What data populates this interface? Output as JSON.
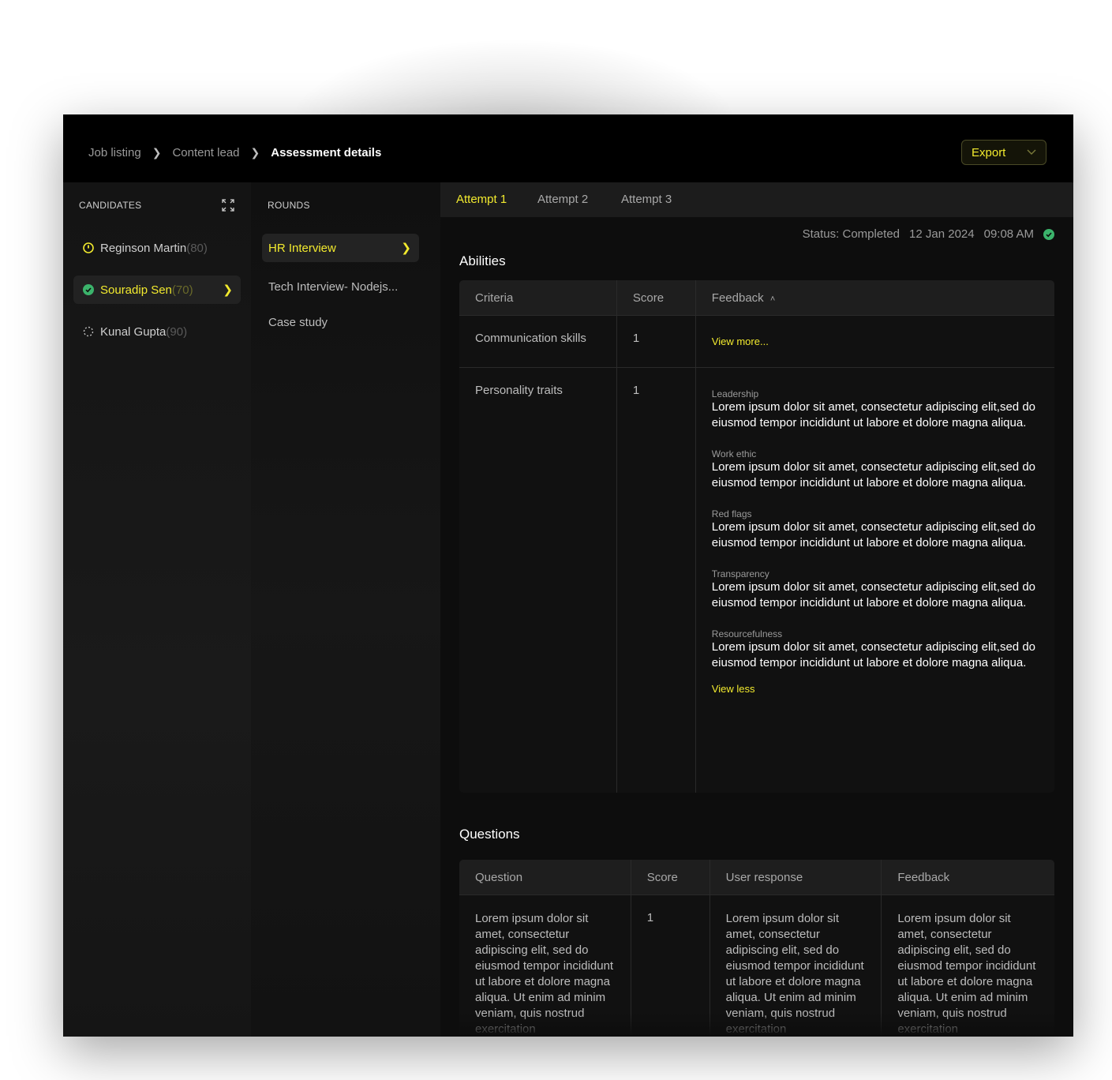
{
  "breadcrumb": {
    "items": [
      "Job listing",
      "Content lead"
    ],
    "current": "Assessment details"
  },
  "export": {
    "label": "Export"
  },
  "candidates": {
    "header": "CANDIDATES",
    "items": [
      {
        "name": "Reginson Martin",
        "score": "(80)",
        "status": "pending"
      },
      {
        "name": "Souradip Sen",
        "score": "(70)",
        "status": "completed"
      },
      {
        "name": "Kunal Gupta",
        "score": "(90)",
        "status": "loading"
      }
    ]
  },
  "rounds": {
    "header": "ROUNDS",
    "items": [
      "HR Interview",
      "Tech Interview- Nodejs...",
      "Case study"
    ]
  },
  "attempts": {
    "tabs": [
      "Attempt 1",
      "Attempt 2",
      "Attempt 3"
    ]
  },
  "status": {
    "label": "Status: Completed",
    "date": "12 Jan 2024",
    "time": "09:08 AM"
  },
  "abilities": {
    "title": "Abilities",
    "columns": [
      "Criteria",
      "Score",
      "Feedback"
    ],
    "rows": [
      {
        "criteria": "Communication skills",
        "score": "1",
        "link": "View more..."
      },
      {
        "criteria": "Personality traits",
        "score": "1",
        "feedback": [
          {
            "label": "Leadership",
            "text": "Lorem ipsum dolor sit amet, consectetur adipiscing elit,sed do eiusmod tempor incididunt ut labore et dolore magna aliqua."
          },
          {
            "label": "Work ethic",
            "text": "Lorem ipsum dolor sit amet, consectetur adipiscing elit,sed do eiusmod tempor incididunt ut labore et dolore magna aliqua."
          },
          {
            "label": "Red flags",
            "text": "Lorem ipsum dolor sit amet, consectetur adipiscing elit,sed do eiusmod tempor incididunt ut labore et dolore magna aliqua."
          },
          {
            "label": "Transparency",
            "text": "Lorem ipsum dolor sit amet, consectetur adipiscing elit,sed do eiusmod tempor incididunt ut labore et dolore magna aliqua."
          },
          {
            "label": "Resourcefulness",
            "text": "Lorem ipsum dolor sit amet, consectetur adipiscing elit,sed do eiusmod tempor incididunt ut labore et dolore magna aliqua."
          }
        ],
        "link": "View less"
      }
    ]
  },
  "questions": {
    "title": "Questions",
    "columns": [
      "Question",
      "Score",
      "User response",
      "Feedback"
    ],
    "rows": [
      {
        "question": "Lorem ipsum dolor sit amet, consectetur adipiscing elit, sed do eiusmod tempor incididunt ut labore et dolore magna aliqua. Ut enim ad minim veniam, quis nostrud exercitation",
        "score": "1",
        "response": "Lorem ipsum dolor sit amet, consectetur adipiscing elit, sed do eiusmod tempor incididunt ut labore et dolore magna aliqua. Ut enim ad minim veniam, quis nostrud exercitation",
        "feedback": "Lorem ipsum dolor sit amet, consectetur adipiscing elit, sed do eiusmod tempor incididunt ut labore et dolore magna aliqua. Ut enim ad minim veniam, quis nostrud exercitation"
      }
    ]
  },
  "colors": {
    "accent": "#f2ea2e",
    "success": "#3bb36b",
    "background": "#141414"
  }
}
